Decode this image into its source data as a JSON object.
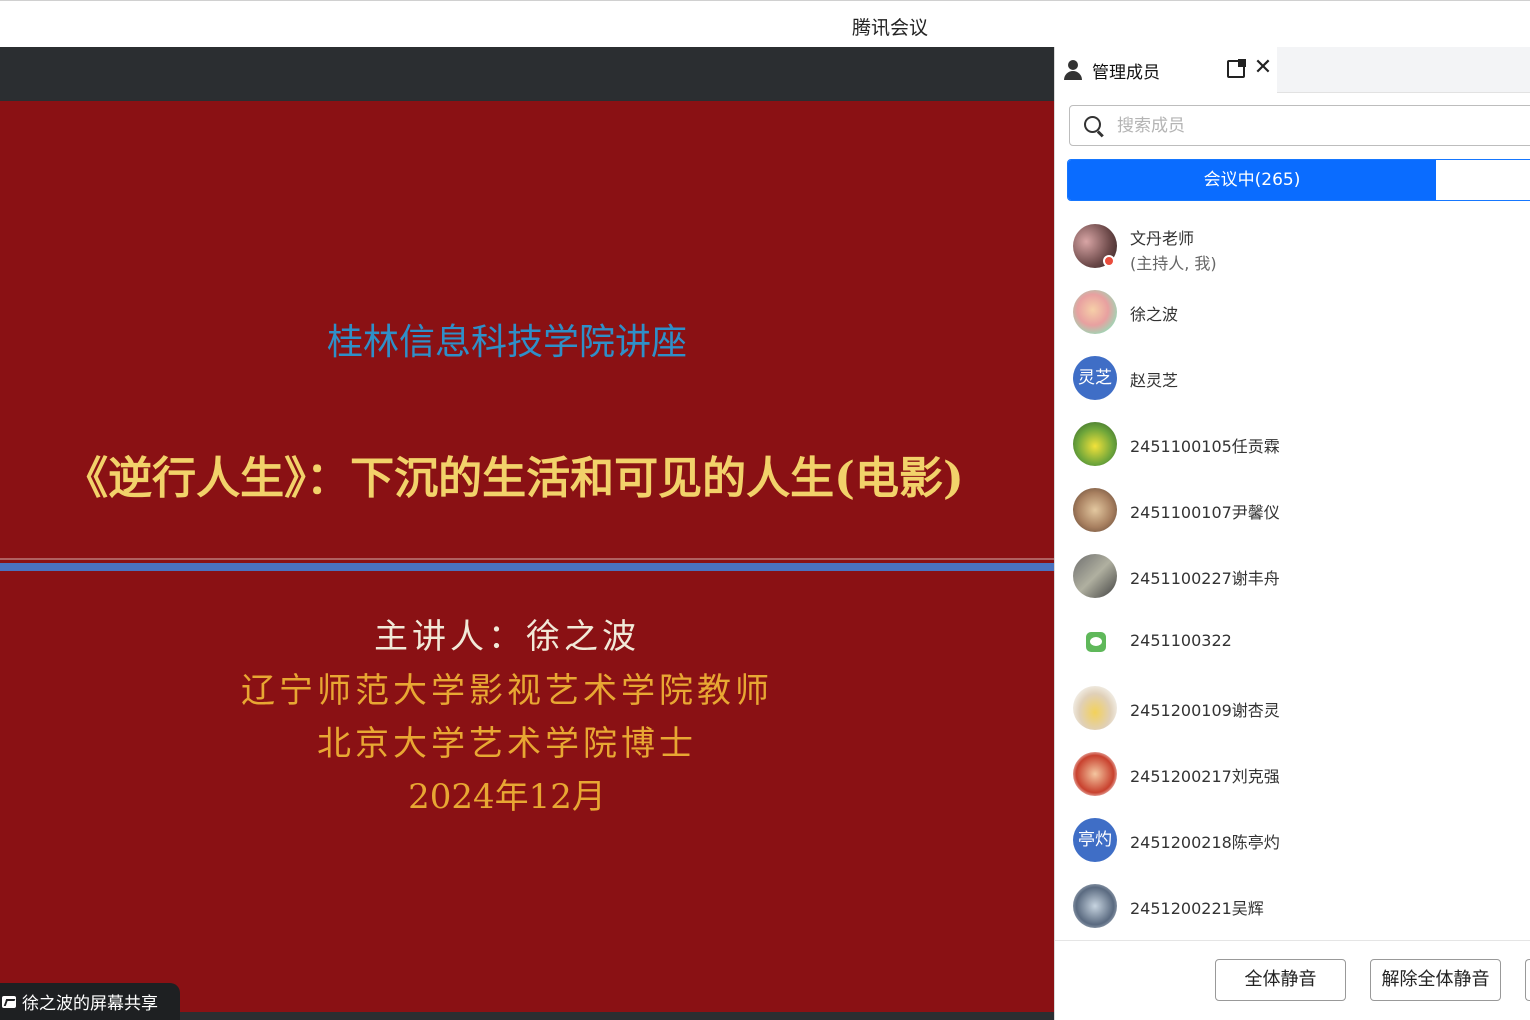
{
  "window": {
    "title": "腾讯会议"
  },
  "slide": {
    "subtitle": "桂林信息科技学院讲座",
    "title": "《逆行人生》：下沉的生活和可见的人生(电影)",
    "speaker": "主讲人：徐之波",
    "org1": "辽宁师范大学影视艺术学院教师",
    "org2": "北京大学艺术学院博士",
    "date": "2024年12月"
  },
  "share_badge": {
    "label": "徐之波的屏幕共享"
  },
  "panel": {
    "tab_label": "管理成员",
    "search_placeholder": "搜索成员",
    "segment_active": "会议中(265)",
    "members": [
      {
        "name": "文丹老师",
        "sub": "(主持人, 我)"
      },
      {
        "name": "徐之波"
      },
      {
        "name": "赵灵芝",
        "avatar_text": "灵芝"
      },
      {
        "name": "2451100105任贡霖"
      },
      {
        "name": "2451100107尹馨仪"
      },
      {
        "name": "2451100227谢丰舟"
      },
      {
        "name": "2451100322"
      },
      {
        "name": "2451200109谢杏灵"
      },
      {
        "name": "2451200217刘克强"
      },
      {
        "name": "2451200218陈亭灼",
        "avatar_text": "亭灼"
      },
      {
        "name": "2451200221吴辉"
      }
    ],
    "footer": {
      "mute_all": "全体静音",
      "unmute_all": "解除全体静音"
    }
  },
  "colors": {
    "accent": "#0a6cff",
    "slide_bg": "#8a1114",
    "slide_gold": "#e8a733"
  }
}
